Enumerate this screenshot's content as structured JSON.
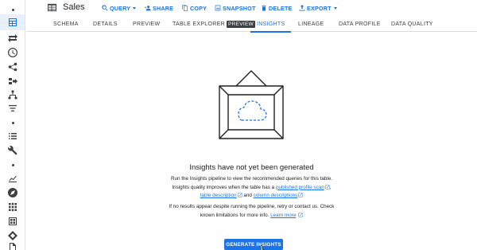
{
  "header": {
    "title": "Sales",
    "actions": [
      {
        "label": "QUERY",
        "icon": "search-icon",
        "dropdown": true
      },
      {
        "label": "SHARE",
        "icon": "person-add-icon"
      },
      {
        "label": "COPY",
        "icon": "copy-icon"
      },
      {
        "label": "SNAPSHOT",
        "icon": "snapshot-icon"
      },
      {
        "label": "DELETE",
        "icon": "trash-icon"
      },
      {
        "label": "EXPORT",
        "icon": "export-icon",
        "dropdown": true
      }
    ]
  },
  "tabs": [
    {
      "label": "SCHEMA"
    },
    {
      "label": "DETAILS"
    },
    {
      "label": "PREVIEW"
    },
    {
      "label": "TABLE EXPLORER",
      "badge": "PREVIEW"
    },
    {
      "label": "INSIGHTS",
      "active": true
    },
    {
      "label": "LINEAGE"
    },
    {
      "label": "DATA PROFILE"
    },
    {
      "label": "DATA QUALITY"
    }
  ],
  "insights": {
    "headline": "Insights have not yet been generated",
    "p1_line1": "Run the Insights pipeline to view the recommended queries for this table.",
    "p1_line2_a": "Insights quality improves when the table has a ",
    "link_profile": "published profile scan",
    "p1_line2_b": ",",
    "link_description": "table description",
    "p1_line3_mid": " and ",
    "link_column": "column descriptions",
    "p2_line1": "If no results appear despite running the pipeline, retry or contact us. Check",
    "p2_line2_a": "known limitations for more info. ",
    "link_learn": "Learn more",
    "button": "GENERATE INSIGHTS"
  },
  "colors": {
    "accent": "#1a73e8",
    "text": "#202124",
    "active_tab_bg": "#e8f0fe"
  }
}
